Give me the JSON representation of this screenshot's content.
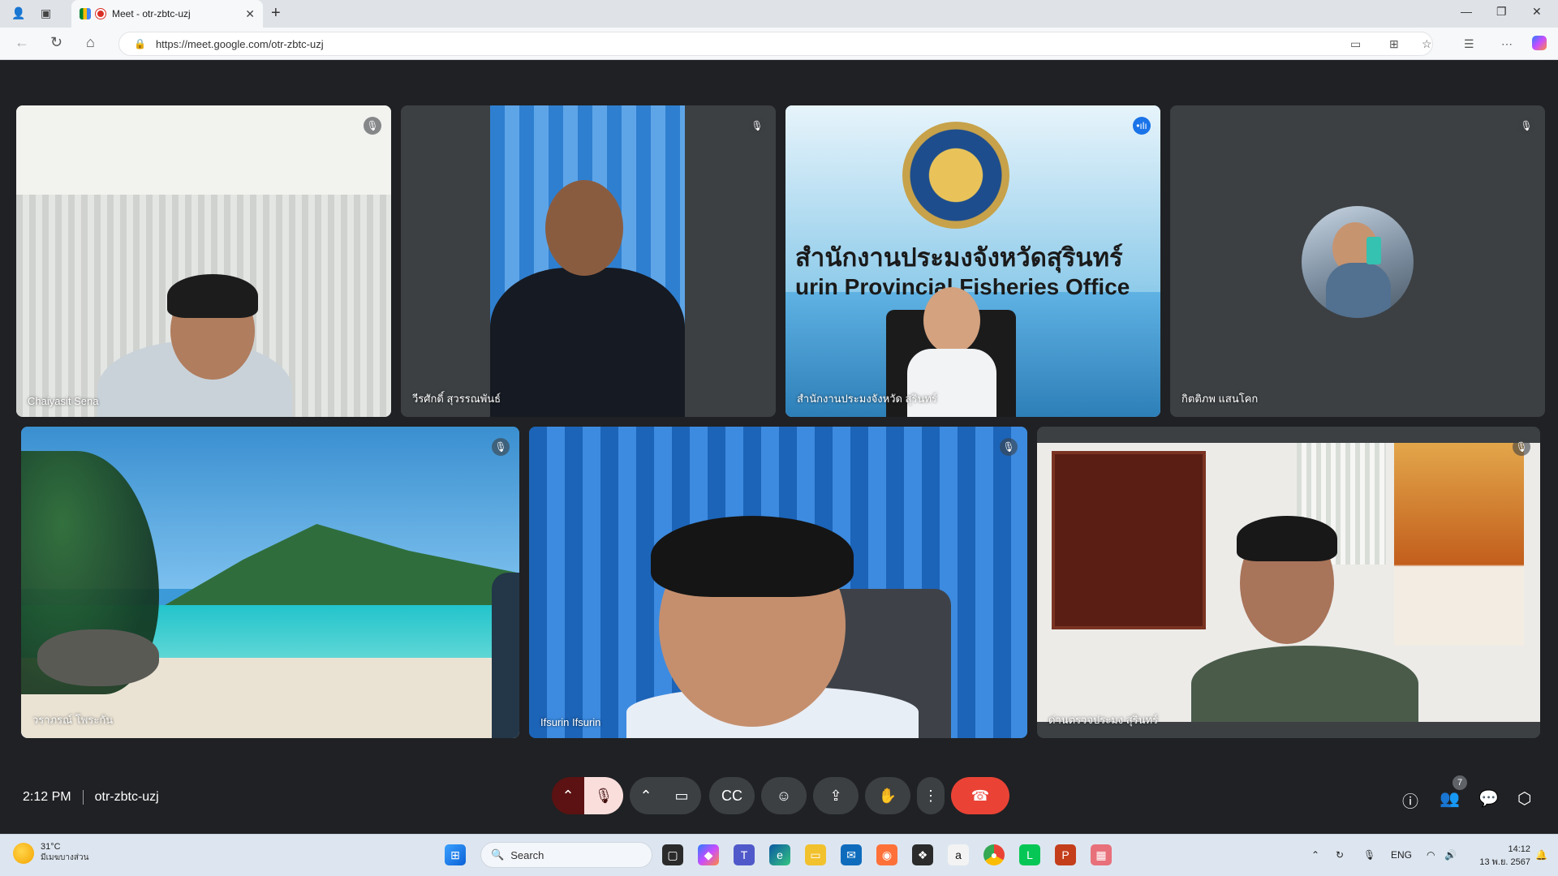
{
  "browser": {
    "tab_title": "Meet - otr-zbtc-uzj",
    "url": "https://meet.google.com/otr-zbtc-uzj"
  },
  "meeting": {
    "time": "2:12 PM",
    "code": "otr-zbtc-uzj",
    "participant_count": "7"
  },
  "participants": [
    {
      "name": "Chaiyasit Sena"
    },
    {
      "name": "วีรศักดิ์ สุวรรณพันธ์"
    },
    {
      "name": "สำนักงานประมงจังหวัด สุรินทร์"
    },
    {
      "name": "กิตติภพ แสนโคก"
    },
    {
      "name": "วราภรณ์ โพระกัน"
    },
    {
      "name": "Ifsurin Ifsurin"
    },
    {
      "name": "ด่านตรวจประมง สุรินทร์"
    }
  ],
  "banner": {
    "thai": "สำนักงานประมงจังหวัดสุรินทร์",
    "english": "urin Provincial Fisheries Office"
  },
  "taskbar": {
    "temperature": "31°C",
    "weather_desc": "มีเมฆบางส่วน",
    "search_placeholder": "Search",
    "language": "ENG",
    "time": "14:12",
    "date": "13 พ.ย. 2567"
  },
  "colors": {
    "meet_bg": "#202124",
    "end_call": "#ea4335",
    "active_outline": "#8ab4f8"
  }
}
